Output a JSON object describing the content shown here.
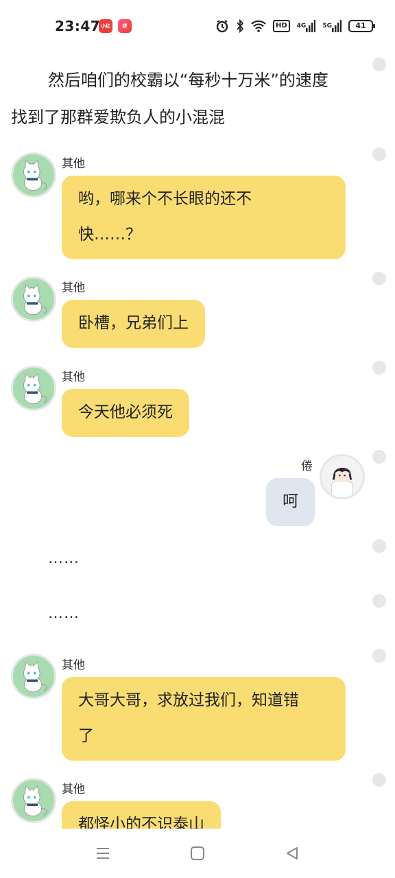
{
  "status_bar": {
    "time": "23:47",
    "app_icons": [
      "小红书",
      "拼"
    ],
    "battery": "41",
    "hd": "HD",
    "net1": "4G",
    "net2": "5G"
  },
  "narration": {
    "line1": "然后咱们的校霸以“每秒十万米”的速度",
    "line2": "找到了那群爱欺负人的小混混"
  },
  "messages": [
    {
      "sender": "其他",
      "text_line1": "哟，哪来个不长眼的还不",
      "text_line2": "快……？"
    },
    {
      "sender": "其他",
      "text": "卧槽，兄弟们上"
    },
    {
      "sender": "其他",
      "text": "今天他必须死"
    },
    {
      "sender": "倦",
      "text": "呵"
    },
    {
      "sender": "其他",
      "text_line1": "大哥大哥，求放过我们，知道错",
      "text_line2": "了"
    },
    {
      "sender": "其他",
      "text": "都怪小的不识泰山"
    }
  ],
  "ellipsis": [
    "……",
    "……"
  ],
  "nav": {
    "menu": "menu-icon",
    "home": "home-icon",
    "back": "back-icon"
  },
  "colors": {
    "bubble_other": "#fadd72",
    "bubble_self": "#dfe6ef",
    "avatar_bg": "#a8dbb0"
  }
}
